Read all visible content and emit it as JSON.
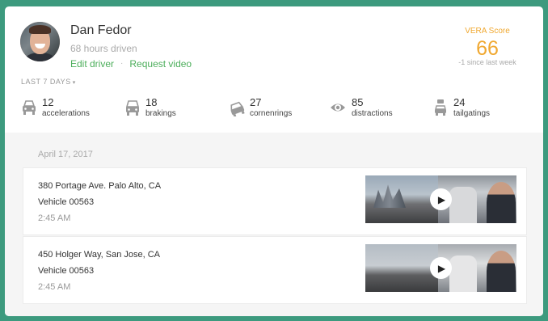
{
  "driver": {
    "name": "Dan Fedor",
    "hours": "68 hours driven",
    "edit_link": "Edit driver",
    "separator": "·",
    "video_link": "Request video"
  },
  "score": {
    "label": "VERA Score",
    "value": "66",
    "delta": "-1 since last week",
    "color": "#f0a830"
  },
  "period": {
    "label": "LAST 7 DAYS",
    "caret": "▾"
  },
  "stats": [
    {
      "icon": "car-front-icon",
      "value": "12",
      "label": "accelerations"
    },
    {
      "icon": "car-braking-icon",
      "value": "18",
      "label": "brakings"
    },
    {
      "icon": "car-turning-icon",
      "value": "27",
      "label": "cornenrings"
    },
    {
      "icon": "eye-icon",
      "value": "85",
      "label": "distractions"
    },
    {
      "icon": "car-tailgating-icon",
      "value": "24",
      "label": "tailgatings"
    }
  ],
  "trips_date": "April 17, 2017",
  "trips": [
    {
      "address": "380 Portage Ave. Palo Alto, CA",
      "vehicle": "Vehicle 00563",
      "time": "2:45 AM"
    },
    {
      "address": "450 Holger Way, San Jose, CA",
      "vehicle": "Vehicle 00563",
      "time": "2:45 AM"
    }
  ],
  "colors": {
    "background": "#3d9a7e",
    "link": "#4cae5b",
    "accent": "#f0a830"
  }
}
